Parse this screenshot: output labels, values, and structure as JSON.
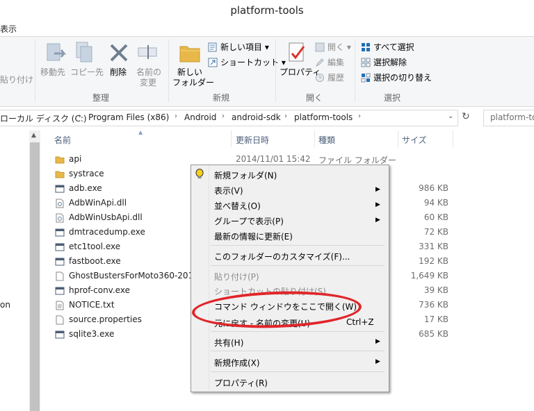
{
  "window": {
    "title": "platform-tools"
  },
  "ribbon": {
    "view_tab": "表示",
    "clipboard": {
      "paste_label": "貼り付け"
    },
    "organize": {
      "move_to": "移動先",
      "copy_to": "コピー先",
      "delete": "削除",
      "rename_line1": "名前の",
      "rename_line2": "変更",
      "group_label": "整理"
    },
    "new": {
      "new_folder_line1": "新しい",
      "new_folder_line2": "フォルダー",
      "new_item": "新しい項目 ▾",
      "shortcut": "ショートカット ▾",
      "group_label": "新規"
    },
    "open": {
      "properties": "プロパティ",
      "open": "開く ▾",
      "edit": "編集",
      "history": "履歴",
      "group_label": "開く"
    },
    "select": {
      "select_all": "すべて選択",
      "select_none": "選択解除",
      "invert_selection": "選択の切り替え",
      "group_label": "選択"
    }
  },
  "address": {
    "crumbs": [
      "ローカル ディスク (C:)",
      "Program Files (x86)",
      "Android",
      "android-sdk",
      "platform-tools"
    ],
    "search_placeholder": "platform-to"
  },
  "sidebar": {
    "partial_item": "on"
  },
  "columns": {
    "name": "名前",
    "date": "更新日時",
    "type": "種類",
    "size": "サイズ"
  },
  "files": [
    {
      "name": "api",
      "date": "2014/11/01 15:42",
      "type": "ファイル フォルダー",
      "size": "",
      "icon": "folder-icon"
    },
    {
      "name": "systrace",
      "date": "",
      "type": "",
      "size": "",
      "icon": "folder-icon"
    },
    {
      "name": "adb.exe",
      "date": "",
      "type": "",
      "size": "986 KB",
      "icon": "exe-icon"
    },
    {
      "name": "AdbWinApi.dll",
      "date": "",
      "type": "",
      "size": "94 KB",
      "icon": "dll-icon"
    },
    {
      "name": "AdbWinUsbApi.dll",
      "date": "",
      "type": "",
      "size": "60 KB",
      "icon": "dll-icon"
    },
    {
      "name": "dmtracedump.exe",
      "date": "",
      "type": "",
      "size": "72 KB",
      "icon": "exe-icon"
    },
    {
      "name": "etc1tool.exe",
      "date": "",
      "type": "",
      "size": "331 KB",
      "icon": "exe-icon"
    },
    {
      "name": "fastboot.exe",
      "date": "",
      "type": "",
      "size": "192 KB",
      "icon": "exe-icon"
    },
    {
      "name": "GhostBustersForMoto360-2014",
      "date": "",
      "type": "",
      "size": "1,649 KB",
      "icon": "file-icon"
    },
    {
      "name": "hprof-conv.exe",
      "date": "",
      "type": "",
      "size": "39 KB",
      "icon": "exe-icon"
    },
    {
      "name": "NOTICE.txt",
      "date": "",
      "type": "",
      "size": "736 KB",
      "icon": "text-file-icon"
    },
    {
      "name": "source.properties",
      "date": "",
      "type": "",
      "size": "17 KB",
      "icon": "file-icon"
    },
    {
      "name": "sqlite3.exe",
      "date": "",
      "type": "",
      "size": "685 KB",
      "icon": "exe-icon"
    }
  ],
  "context_menu": {
    "new_folder": "新規フォルダ(N)",
    "view": "表示(V)",
    "sort_by": "並べ替え(O)",
    "group_by": "グループで表示(P)",
    "refresh": "最新の情報に更新(E)",
    "customize": "このフォルダーのカスタマイズ(F)...",
    "paste": "貼り付け(P)",
    "paste_shortcut": "ショートカットの貼り付け(S)",
    "open_command_window": "コマンド ウィンドウをここで開く(W)",
    "undo": "元に戻す - 名前の変更(U)",
    "undo_shortcut": "Ctrl+Z",
    "share": "共有(H)",
    "new": "新規作成(X)",
    "properties": "プロパティ(R)"
  },
  "colors": {
    "highlight_ellipse": "#e0262a",
    "folder": "#e8b84a",
    "select_blue": "#1f6fb5"
  }
}
